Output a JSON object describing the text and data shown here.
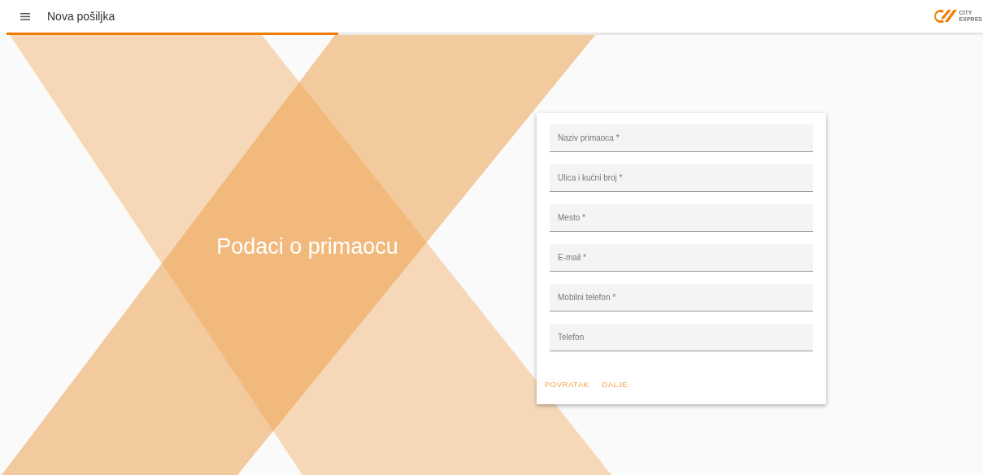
{
  "header": {
    "title": "Nova pošiljka",
    "logo": [
      "CITY",
      "EXPRES"
    ]
  },
  "progress": {
    "level": 0.34
  },
  "heading": "Podaci o primaocu",
  "form": {
    "fields": [
      {
        "placeholder": "Naziv primaoca *"
      },
      {
        "placeholder": "Ulica i kućni broj *"
      },
      {
        "placeholder": "Mesto *"
      },
      {
        "placeholder": "E-mail *"
      },
      {
        "placeholder": "Mobilni telefon *"
      },
      {
        "placeholder": "Telefon"
      }
    ],
    "buttons": [
      "POVRATAK",
      "DALJE"
    ]
  }
}
